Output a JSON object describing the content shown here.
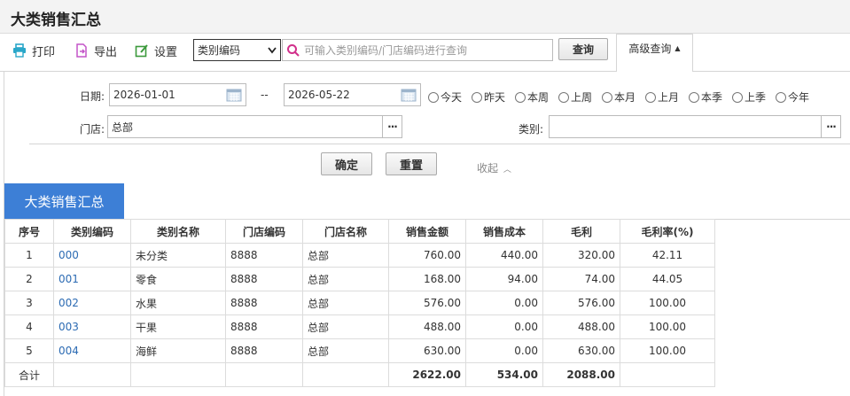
{
  "page": {
    "title": "大类销售汇总"
  },
  "toolbar": {
    "print_label": "打印",
    "export_label": "导出",
    "settings_label": "设置",
    "select_value": "类别编码",
    "search_placeholder": "可输入类别编码/门店编码进行查询",
    "query_label": "查询",
    "advanced_label": "高级查询"
  },
  "filters": {
    "date_label": "日期:",
    "date_from": "2026-01-01",
    "date_separator": "--",
    "date_to": "2026-05-22",
    "quick_ranges": [
      "今天",
      "昨天",
      "本周",
      "上周",
      "本月",
      "上月",
      "本季",
      "上季",
      "今年"
    ],
    "store_label": "门店:",
    "store_value": "总部",
    "category_label": "类别:",
    "category_value": "",
    "picker_dots": "···",
    "confirm_label": "确定",
    "reset_label": "重置",
    "collapse_label": "收起"
  },
  "section": {
    "tab_label": "大类销售汇总"
  },
  "table": {
    "headers": [
      "序号",
      "类别编码",
      "类别名称",
      "门店编码",
      "门店名称",
      "销售金额",
      "销售成本",
      "毛利",
      "毛利率(%)"
    ],
    "rows": [
      [
        "1",
        "000",
        "未分类",
        "8888",
        "总部",
        "760.00",
        "440.00",
        "320.00",
        "42.11"
      ],
      [
        "2",
        "001",
        "零食",
        "8888",
        "总部",
        "168.00",
        "94.00",
        "74.00",
        "44.05"
      ],
      [
        "3",
        "002",
        "水果",
        "8888",
        "总部",
        "576.00",
        "0.00",
        "576.00",
        "100.00"
      ],
      [
        "4",
        "003",
        "干果",
        "8888",
        "总部",
        "488.00",
        "0.00",
        "488.00",
        "100.00"
      ],
      [
        "5",
        "004",
        "海鲜",
        "8888",
        "总部",
        "630.00",
        "0.00",
        "630.00",
        "100.00"
      ]
    ],
    "total": {
      "label": "合计",
      "sales": "2622.00",
      "cost": "534.00",
      "profit": "2088.00"
    }
  },
  "colors": {
    "accent": "#3d7fd6",
    "link": "#2c6bb3"
  }
}
